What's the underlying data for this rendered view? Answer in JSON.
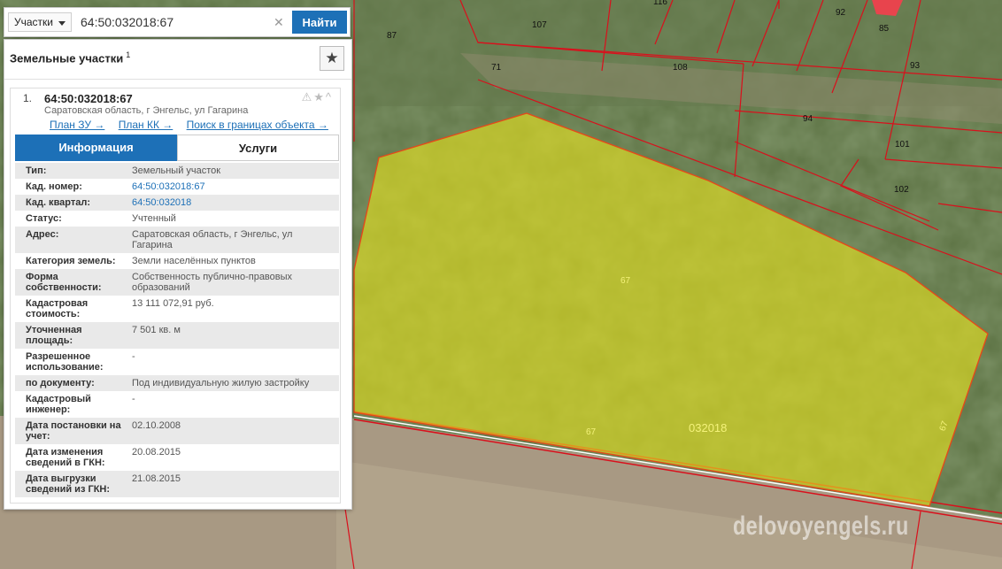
{
  "search": {
    "type_select": "Участки",
    "query": "64:50:032018:67",
    "button_label": "Найти"
  },
  "panel": {
    "title": "Земельные участки",
    "count": "1"
  },
  "card": {
    "index": "1.",
    "cadastral_number": "64:50:032018:67",
    "address": "Саратовская область, г Энгельс, ул Гагарина",
    "links": [
      "План ЗУ →",
      "План КК →",
      "Поиск в границах объекта →"
    ]
  },
  "tabs": [
    "Информация",
    "Услуги"
  ],
  "rows": [
    {
      "label": "Тип:",
      "value": "Земельный участок"
    },
    {
      "label": "Кад. номер:",
      "value": "64:50:032018:67"
    },
    {
      "label": "Кад. квартал:",
      "value": "64:50:032018"
    },
    {
      "label": "Статус:",
      "value": "Учтенный"
    },
    {
      "label": "Адрес:",
      "value": "Саратовская область, г Энгельс, ул Гагарина"
    },
    {
      "label": "Категория земель:",
      "value": "Земли населённых пунктов"
    },
    {
      "label": "Форма собственности:",
      "value": "Собственность публично-правовых образований"
    },
    {
      "label": "Кадастровая стоимость:",
      "value": "13 111 072,91 руб."
    },
    {
      "label": "Уточненная площадь:",
      "value": "7 501 кв. м"
    },
    {
      "label": "Разрешенное использование:",
      "value": "-"
    },
    {
      "label": "по документу:",
      "value": "Под индивидуальную жилую застройку"
    },
    {
      "label": "Кадастровый инженер:",
      "value": "-"
    },
    {
      "label": "Дата постановки на учет:",
      "value": "02.10.2008"
    },
    {
      "label": "Дата изменения сведений в ГКН:",
      "value": "20.08.2015"
    },
    {
      "label": "Дата выгрузки сведений из ГКН:",
      "value": "21.08.2015"
    }
  ],
  "map": {
    "parcel_labels": [
      "87",
      "107",
      "116",
      "92",
      "85",
      "71",
      "108",
      "93",
      "94",
      "101",
      "102"
    ],
    "parcel_labels_yellow": [
      "67",
      "67",
      "67"
    ],
    "quarter_label": "032018",
    "watermark": "delovoyengels.ru"
  },
  "colors": {
    "accent": "#1d70b7",
    "parcel_fill": "#e6e21e",
    "boundary": "#d9101c"
  }
}
